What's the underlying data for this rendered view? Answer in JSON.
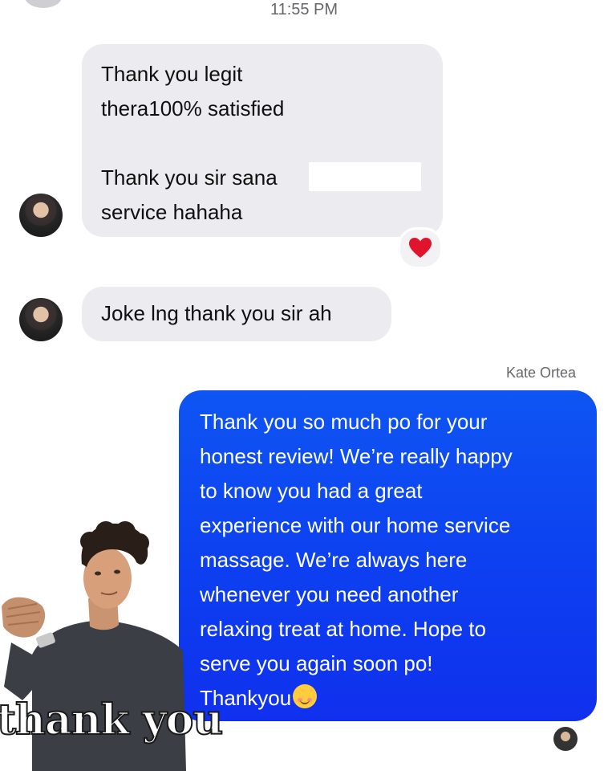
{
  "conversation": {
    "timestamp": "11:55 PM",
    "incoming": [
      {
        "lines": [
          "Thank you legit",
          "thera100% satisfied",
          "",
          "Thank you sir sana",
          "service hahaha"
        ],
        "reaction": "heart-icon"
      },
      {
        "lines": [
          "Joke lng thank you sir ah"
        ]
      }
    ],
    "outgoing": {
      "sender_name": "Kate Ortea",
      "lines": [
        "Thank you so much po for your",
        "honest review! We’re really happy",
        "to know you had a great",
        "experience with our home service",
        "massage. We’re always here",
        "whenever you need another",
        "relaxing treat at home. Hope to",
        "serve you again soon po!",
        "Thankyou"
      ],
      "trailing_emoji": "smiling-face-emoji"
    },
    "sticker": {
      "text": "thank you"
    }
  },
  "colors": {
    "incoming_bubble": "#ececf0",
    "outgoing_bubble": "#0d3ff0",
    "meta_text": "#65676b"
  }
}
